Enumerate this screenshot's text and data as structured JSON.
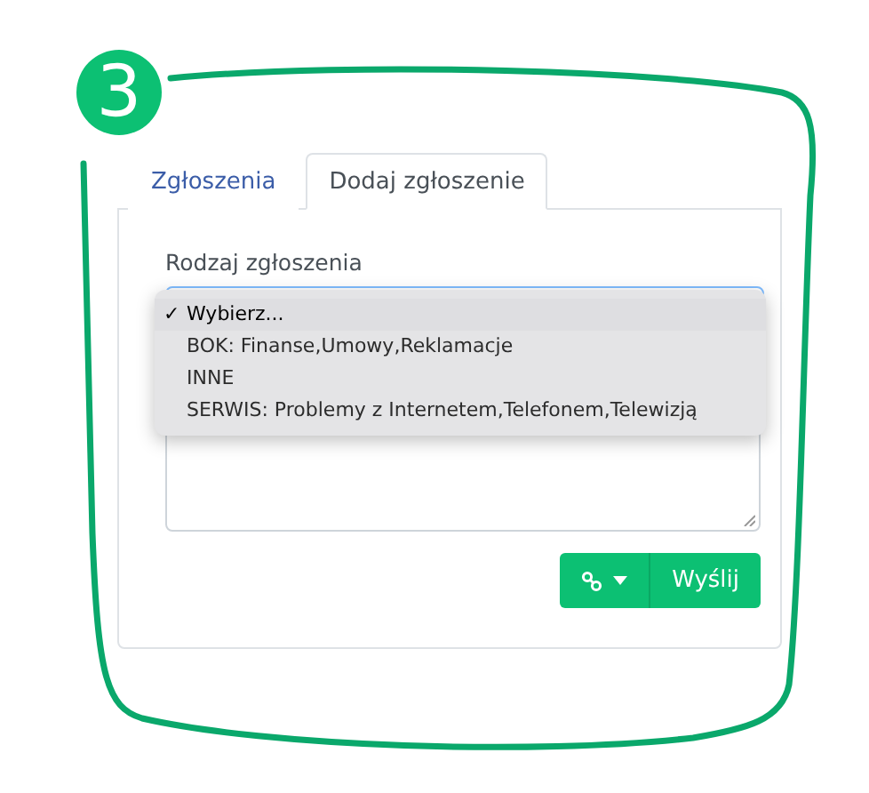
{
  "step_badge": "3",
  "tabs": [
    {
      "label": "Zgłoszenia",
      "selected": false
    },
    {
      "label": "Dodaj zgłoszenie",
      "selected": true
    }
  ],
  "form": {
    "type_label": "Rodzaj zgłoszenia",
    "check_mark": "✓",
    "type_options": [
      {
        "label": "Wybierz...",
        "selected": true
      },
      {
        "label": "BOK: Finanse,Umowy,Reklamacje",
        "selected": false
      },
      {
        "label": "INNE",
        "selected": false
      },
      {
        "label": "SERWIS: Problemy z Internetem,Telefonem,Telewizją",
        "selected": false
      }
    ],
    "submit": "Wyślij"
  }
}
